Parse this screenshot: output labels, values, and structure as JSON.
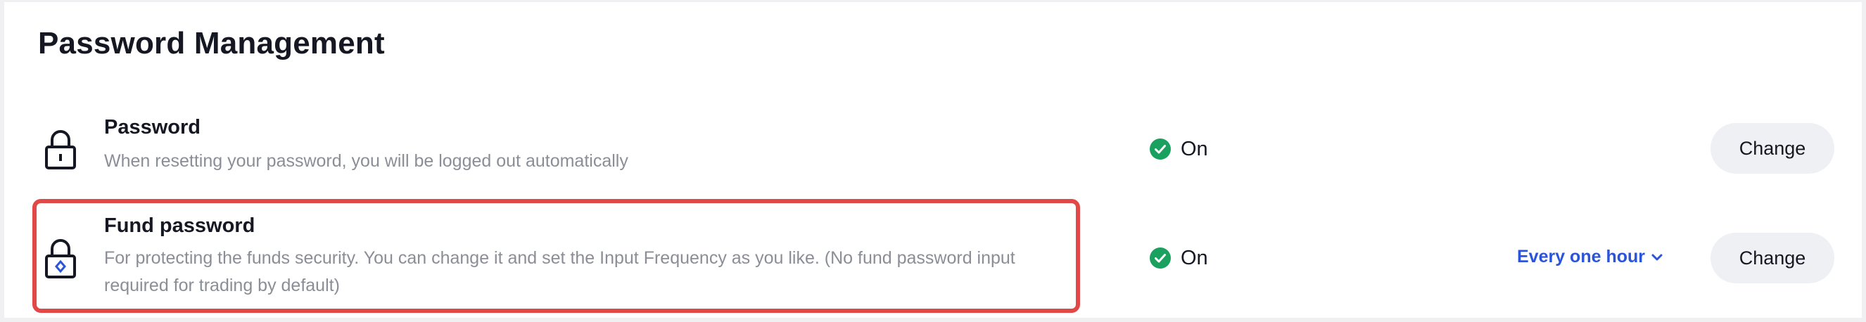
{
  "page_title": "Password Management",
  "rows": [
    {
      "icon": "lock-icon",
      "title": "Password",
      "description": "When resetting your password, you will be logged out automatically",
      "status": "On",
      "status_icon": "check-circle-icon",
      "action_label": "Change"
    },
    {
      "icon": "lock-diamond-icon",
      "title": "Fund password",
      "description": "For protecting the funds security. You can change it and set the Input Frequency as you like. (No fund password input required for trading by default)",
      "status": "On",
      "status_icon": "check-circle-icon",
      "frequency": "Every one hour",
      "action_label": "Change"
    }
  ],
  "colors": {
    "status_green": "#1aa15f",
    "link_blue": "#2a54d9",
    "highlight_red": "#e34848",
    "button_bg": "#eef0f3"
  }
}
